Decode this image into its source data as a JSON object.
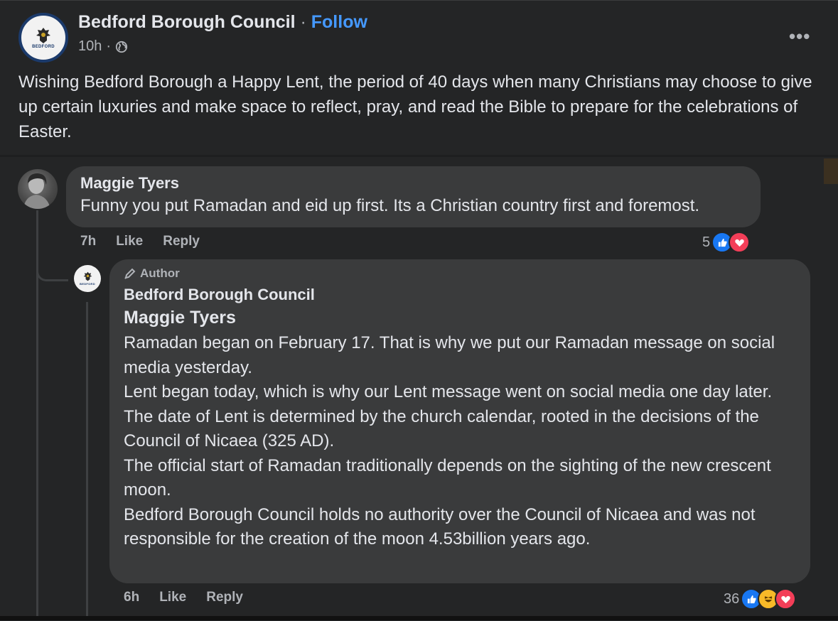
{
  "post": {
    "page_name": "Bedford Borough Council",
    "separator": "·",
    "follow_label": "Follow",
    "time": "10h",
    "time_separator": "·",
    "audience_icon": "globe-icon",
    "more_icon": "•••",
    "text": "Wishing Bedford Borough a Happy Lent, the period of 40 days when many Christians may choose to give up certain luxuries and make space to reflect, pray, and read the Bible to prepare for the celebrations of Easter.",
    "avatar_text": "BEDFORD"
  },
  "comment1": {
    "author": "Maggie Tyers",
    "text": "Funny you put Ramadan and eid up first. Its a Christian country first and foremost.",
    "time": "7h",
    "like_label": "Like",
    "reply_label": "Reply",
    "reaction_count": "5",
    "reactions": [
      "like-icon",
      "love-icon"
    ]
  },
  "comment2": {
    "badge": "Author",
    "author": "Bedford Borough Council",
    "mention": "Maggie Tyers",
    "lines": [
      "Ramadan began on February 17. That is why we put our Ramadan message on social media yesterday.",
      "Lent began today, which is why our Lent message went on social media one day later.",
      "The date of Lent is determined by the church calendar, rooted in the decisions of the Council of Nicaea (325 AD).",
      "The official start of Ramadan traditionally depends on the sighting of the new crescent moon.",
      "Bedford Borough Council holds no authority over the Council of Nicaea and was not responsible for the creation of the moon 4.53billion years ago."
    ],
    "time": "6h",
    "like_label": "Like",
    "reply_label": "Reply",
    "reaction_count": "36",
    "reactions": [
      "like-icon",
      "haha-icon",
      "love-icon"
    ]
  },
  "colors": {
    "background": "#242526",
    "bubble": "#3a3b3c",
    "follow": "#4599ff",
    "like": "#1877f2",
    "love": "#f33e58",
    "haha": "#f7b928"
  }
}
